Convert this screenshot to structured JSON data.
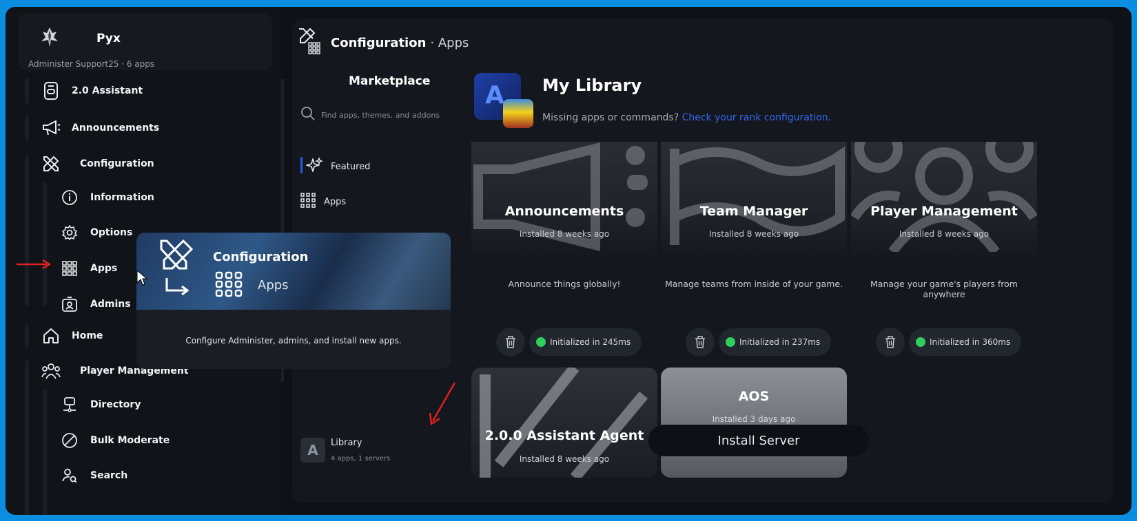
{
  "profile": {
    "name": "Pyx",
    "subtitle": "Administer Support25 · 6 apps"
  },
  "nav": {
    "assistant": "2.0 Assistant",
    "announcements": "Announcements",
    "configuration": "Configuration",
    "information": "Information",
    "options": "Options",
    "apps": "Apps",
    "admins": "Admins",
    "home": "Home",
    "player_management": "Player Management",
    "directory": "Directory",
    "bulk_moderate": "Bulk Moderate",
    "search": "Search"
  },
  "breadcrumb": {
    "section": "Configuration",
    "page": "· Apps"
  },
  "marketplace": {
    "title": "Marketplace",
    "search_placeholder": "Find apps, themes, and addons",
    "featured": "Featured",
    "apps": "Apps",
    "library_label": "Library",
    "library_sub": "4 apps, 1 servers",
    "library_glyph": "A"
  },
  "library": {
    "title": "My Library",
    "missing_text": "Missing apps or commands?",
    "missing_link": "Check your rank configuration.",
    "logo_letter": "A"
  },
  "cards": [
    {
      "name": "Announcements",
      "installed": "Installed 8 weeks ago",
      "description": "Announce things globally!",
      "init": "Initialized in 245ms"
    },
    {
      "name": "Team Manager",
      "installed": "Installed 8 weeks ago",
      "description": "Manage teams from inside of your game.",
      "init": "Initialized in 237ms"
    },
    {
      "name": "Player Management",
      "installed": "Installed 8 weeks ago",
      "description": "Manage your game's players from anywhere",
      "init": "Initialized in 360ms"
    }
  ],
  "cards_row2": [
    {
      "name": "2.0.0 Assistant Agent",
      "installed": "Installed 8 weeks ago"
    },
    {
      "name": "AOS",
      "installed": "Installed 3 days ago"
    }
  ],
  "install_button": "Install Server",
  "popup": {
    "title": "Configuration",
    "subtitle": "Apps",
    "description": "Configure Administer, admins, and install new apps."
  },
  "colors": {
    "accent": "#2b59e6",
    "status_ok": "#2fcf5b",
    "link": "#3567f0",
    "frame": "#0b8de0"
  }
}
